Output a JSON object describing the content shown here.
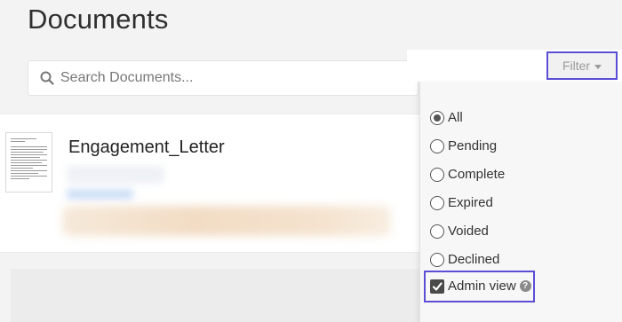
{
  "page": {
    "title": "Documents"
  },
  "search": {
    "placeholder": "Search Documents..."
  },
  "filter": {
    "button_label": "Filter",
    "options": [
      {
        "label": "All",
        "checked": true
      },
      {
        "label": "Pending",
        "checked": false
      },
      {
        "label": "Complete",
        "checked": false
      },
      {
        "label": "Expired",
        "checked": false
      },
      {
        "label": "Voided",
        "checked": false
      },
      {
        "label": "Declined",
        "checked": false
      }
    ],
    "admin_view": {
      "label": "Admin view",
      "checked": true
    }
  },
  "documents": [
    {
      "title": "Engagement_Letter"
    }
  ],
  "colors": {
    "highlight": "#5b4fd6",
    "status_green": "#3aa55a",
    "accent_orange": "#e8b23a"
  }
}
